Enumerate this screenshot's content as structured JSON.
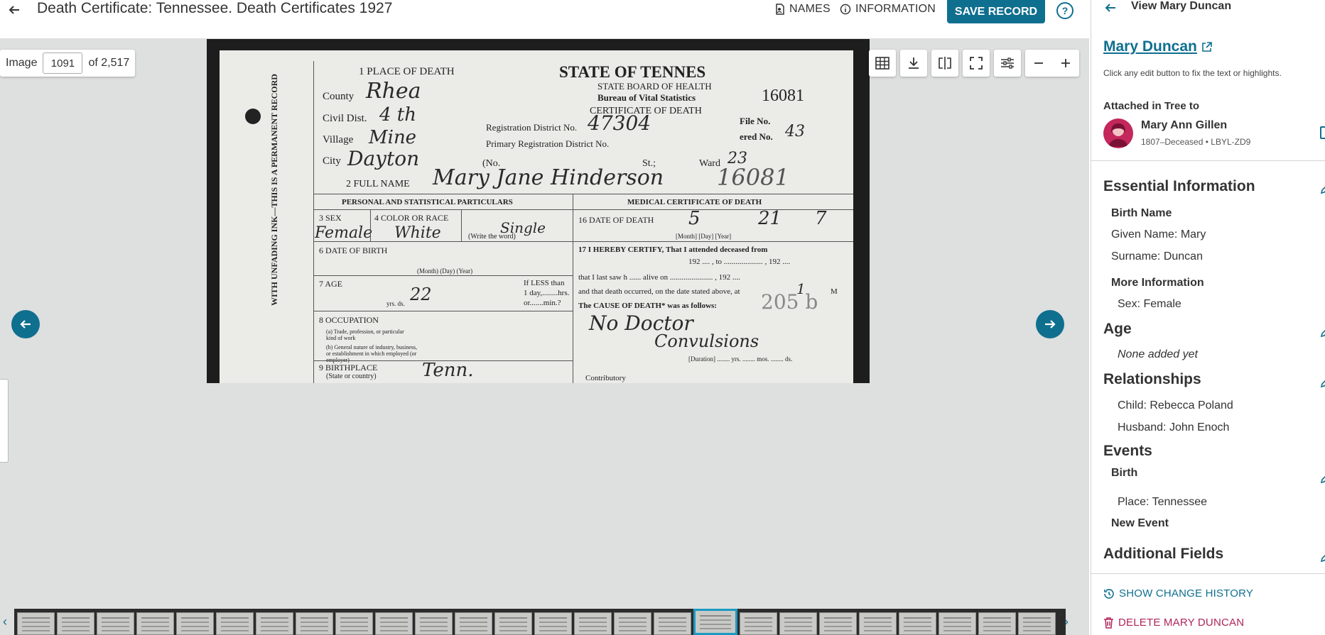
{
  "header": {
    "title": "Death Certificate: Tennessee. Death Certificates 1927",
    "names_label": "NAMES",
    "information_label": "INFORMATION",
    "save_label": "SAVE RECORD",
    "help_label": "?"
  },
  "viewer": {
    "image_label": "Image",
    "image_number": "1091",
    "image_total": "of 2,517"
  },
  "document": {
    "place_of_death": "1 PLACE OF DEATH",
    "state_title": "STATE OF TENNES",
    "board": "STATE BOARD OF HEALTH",
    "bureau": "Bureau of Vital Statistics",
    "cert": "CERTIFICATE OF DEATH",
    "number": "16081",
    "county": "County",
    "county_val": "Rhea",
    "civil_dist": "Civil Dist.",
    "civil_val": "4 th",
    "village": "Village",
    "village_val": "Mine",
    "city": "City",
    "city_val": "Dayton",
    "reg_dist": "Registration District No.",
    "reg_val": "47304",
    "primary_reg": "Primary Registration District No.",
    "file_no": "File No.",
    "reg_no": "ered No.",
    "reg_no_val": "43",
    "no_label": "(No.",
    "st_label": "St.;",
    "ward_label": "Ward",
    "ward_val": "23",
    "full_name": "2 FULL NAME",
    "full_name_val": "Mary Jane Hinderson",
    "name_number": "16081",
    "side_text": "WITH UNFADING INK—THIS IS A PERMANENT RECORD",
    "personal": "PERSONAL AND STATISTICAL PARTICULARS",
    "medical": "MEDICAL CERTIFICATE OF DEATH",
    "sex": "3 SEX",
    "sex_val": "Female",
    "color": "4 COLOR OR RACE",
    "color_val": "White",
    "marital_val": "Single",
    "write_word": "(Write the word)",
    "date_death": "16 DATE OF DEATH",
    "dd_month": "5",
    "dd_day": "21",
    "dd_year": "7",
    "month_day_year": "[Month]          [Day]       [Year]",
    "dob": "6 DATE OF BIRTH",
    "dob_cols": "(Month)         (Day)          (Year)",
    "certify": "17     I HEREBY CERTIFY, That I attended deceased from",
    "certify2": "192 .... , to .................... , 192 ....",
    "last_saw": "that I last saw h ...... alive on ...................... , 192 ....",
    "occurred": "and that death occurred, on the date stated above, at",
    "occurred_val": "1",
    "occurred_m": "M",
    "age": "7 AGE",
    "age_val": "22",
    "age_units": "yrs.                     ds.",
    "if_less": "If LESS than",
    "one_day": "1 day,........hrs.",
    "or_min": "or.......min.?",
    "cause": "The CAUSE OF DEATH* was as follows:",
    "cause_code": "205 b",
    "cause_val1": "No Doctor",
    "cause_val2": "Convulsions",
    "occupation": "8 OCCUPATION",
    "occ_a": "(a)  Trade, profession, or particular kind of work",
    "occ_b": "(b)  General nature of industry, business, or establishment in which employed (or employer)",
    "duration": "[Duration] ........ yrs. ........ mos. ........ ds.",
    "birthplace": "9 BIRTHPLACE",
    "birthplace_sub": "(State or country)",
    "birthplace_val": "Tenn.",
    "contributory": "Contributory"
  },
  "panel": {
    "view_title": "View Mary Duncan",
    "name": "Mary Duncan",
    "hint": "Click any edit button to fix the text or highlights.",
    "attached_label": "Attached in Tree to",
    "attached_person": "Mary Ann Gillen",
    "attached_meta": "1807–Deceased • LBYL-ZD9",
    "essential_h": "Essential Information",
    "birth_name_h": "Birth Name",
    "given_name": "Given Name: Mary",
    "surname": "Surname: Duncan",
    "more_info_h": "More Information",
    "sex": "Sex: Female",
    "age_h": "Age",
    "age_none": "None added yet",
    "relationships_h": "Relationships",
    "child": "Child: Rebecca Poland",
    "husband": "Husband: John Enoch",
    "events_h": "Events",
    "birth_h": "Birth",
    "birth_place": "Place: Tennessee",
    "new_event": "New Event",
    "additional_h": "Additional Fields",
    "change_history": "SHOW CHANGE HISTORY",
    "delete_label": "DELETE MARY DUNCAN"
  },
  "colors": {
    "accent": "#0f6f8f",
    "delete": "#b0245a",
    "viewer_bg": "#dedfdf"
  },
  "icons": [
    "back-arrow-icon",
    "names-icon",
    "info-icon",
    "help-icon",
    "grid-icon",
    "download-icon",
    "compare-icon",
    "fullscreen-icon",
    "adjust-icon",
    "zoom-out-icon",
    "zoom-in-icon",
    "prev-arrow-icon",
    "next-arrow-icon",
    "external-link-icon",
    "edit-icon",
    "history-icon",
    "trash-icon"
  ]
}
